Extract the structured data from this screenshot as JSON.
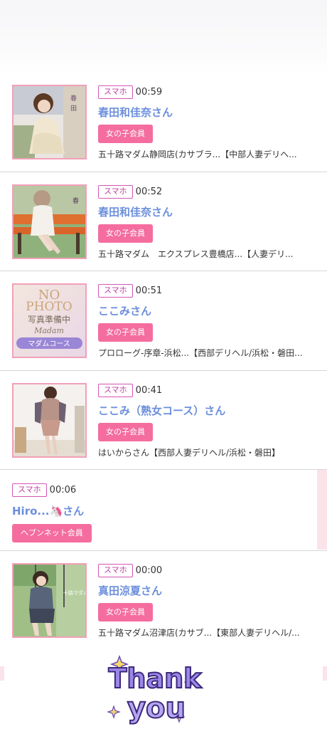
{
  "entries": [
    {
      "device": "スマホ",
      "time": "00:59",
      "name": "春田和佳奈さん",
      "member": "女の子会員",
      "shop": "五十路マダム静岡店(カサブラ...【中部人妻デリヘ..."
    },
    {
      "device": "スマホ",
      "time": "00:52",
      "name": "春田和佳奈さん",
      "member": "女の子会員",
      "shop": "五十路マダム　エクスプレス豊橋店...【人妻デリ..."
    },
    {
      "device": "スマホ",
      "time": "00:51",
      "name": "ここみさん",
      "member": "女の子会員",
      "shop": "プロローグ-序章-浜松...【西部デリヘル/浜松・磐田..."
    },
    {
      "device": "スマホ",
      "time": "00:41",
      "name": "ここみ（熟女コース）さん",
      "member": "女の子会員",
      "shop": "はいからさん【西部人妻デリヘル/浜松・磐田】"
    },
    {
      "device": "スマホ",
      "time": "00:06",
      "name": "Hiro...🦄さん",
      "member": "ヘブンネット会員",
      "shop": ""
    },
    {
      "device": "スマホ",
      "time": "00:00",
      "name": "真田涼夏さん",
      "member": "女の子会員",
      "shop": "五十路マダム沼津店(カサブ...【東部人妻デリヘル/..."
    }
  ],
  "thumb_texts": {
    "no_photo_line1": "NO",
    "no_photo_line2": "PHOTO",
    "no_photo_line3": "写真準備中",
    "madam_course": "マダムコース",
    "madam_script": "Madam"
  },
  "thanks": {
    "line1": "Thank",
    "line2": "you"
  },
  "colors": {
    "accent_pink": "#f46d9e",
    "device_badge_border": "#d654b6",
    "name_blue": "#6c8fdc",
    "thumb_border": "#f2a0b8",
    "thanks_purple": "#8b74e6"
  }
}
